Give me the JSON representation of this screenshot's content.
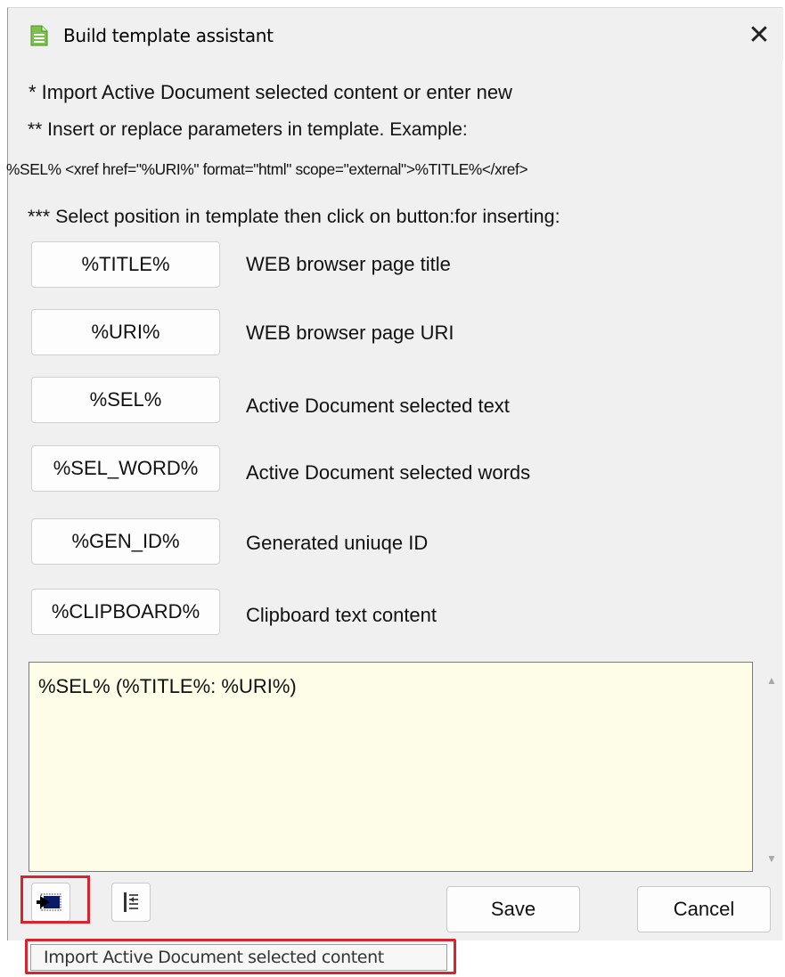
{
  "window": {
    "title": "Build template assistant",
    "close_glyph": "✕"
  },
  "instructions": {
    "line1": "*  Import Active Document selected content or enter new",
    "line2": "** Insert or replace parameters in template. Example:",
    "example": "%SEL% <xref href=\"%URI%\" format=\"html\" scope=\"external\">%TITLE%</xref>",
    "line3": "*** Select position in template then click on button:for inserting:"
  },
  "parameters": [
    {
      "label": "%TITLE%",
      "description": "WEB browser page title"
    },
    {
      "label": "%URI%",
      "description": "WEB browser page URI"
    },
    {
      "label": "%SEL%",
      "description": "Active Document selected text"
    },
    {
      "label": "%SEL_WORD%",
      "description": "Active Document selected words"
    },
    {
      "label": "%GEN_ID%",
      "description": "Generated uniuqe ID"
    },
    {
      "label": "%CLIPBOARD%",
      "description": "Clipboard text content"
    }
  ],
  "template_editor": {
    "value": "%SEL% (%TITLE%: %URI%)"
  },
  "toolbar": {
    "import_icon": "import-content-icon",
    "format_icon": "format-text-icon"
  },
  "buttons": {
    "save": "Save",
    "cancel": "Cancel"
  },
  "tooltip": {
    "text": "Import Active Document selected content"
  },
  "colors": {
    "window_bg": "#f0f0f0",
    "editor_bg": "#fefee8",
    "highlight": "#d9242d"
  }
}
